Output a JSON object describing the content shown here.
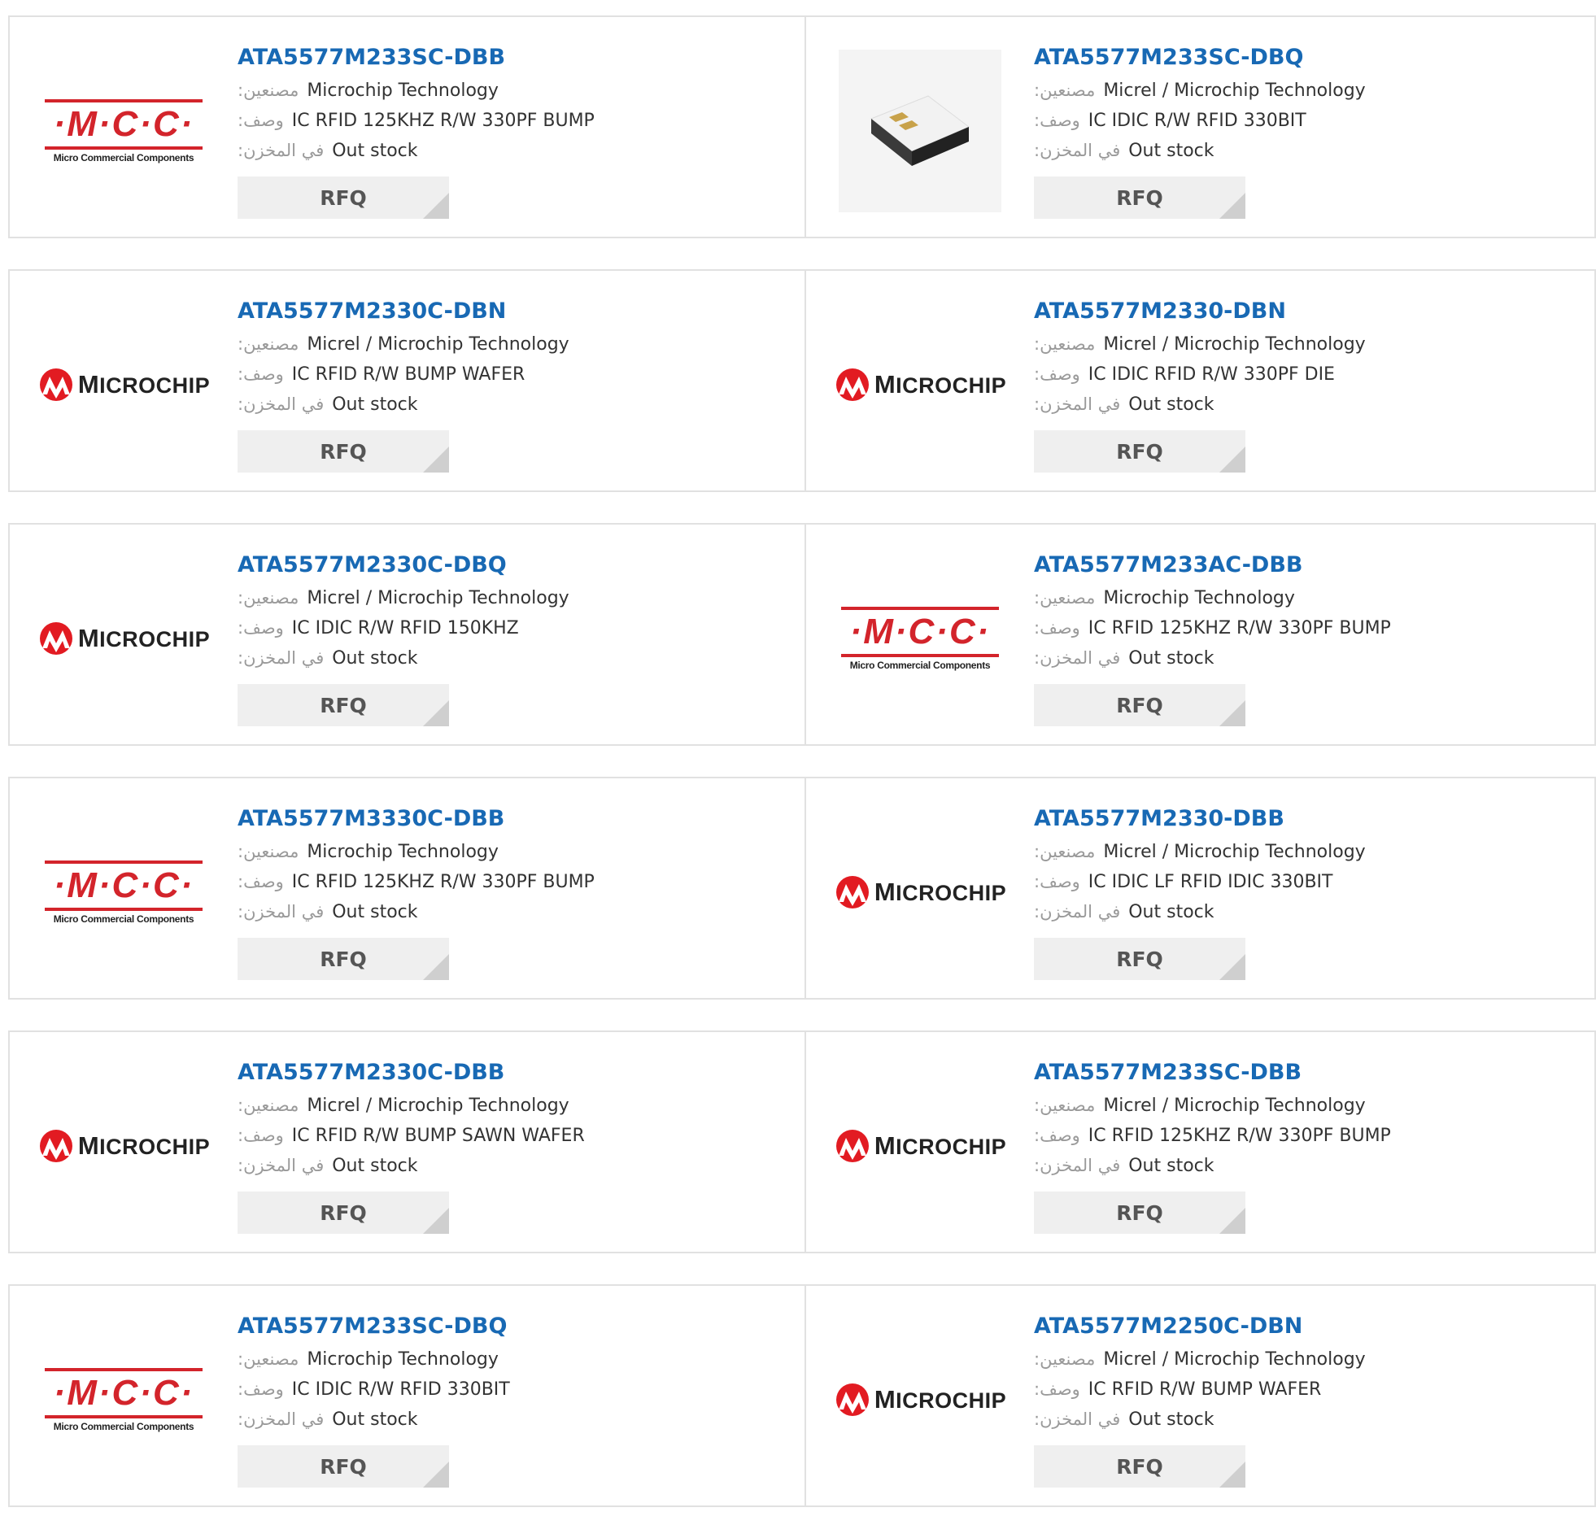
{
  "labels": {
    "manufacturer": ":مصنعين",
    "description": ":وصف",
    "stock": ":في المخزن",
    "rfq": "RFQ"
  },
  "logos": {
    "mcc": {
      "mark": "·M·C·C·",
      "sub": "Micro Commercial Components"
    },
    "microchip": {
      "first": "M",
      "rest": "ICROCHIP"
    }
  },
  "colors": {
    "accent": "#1869b4",
    "mcc_red": "#d3242b",
    "microchip_red": "#e21b22"
  },
  "products": [
    {
      "part": "ATA5577M233SC-DBB",
      "logo": "mcc",
      "manufacturer": "Microchip Technology",
      "description": "IC RFID 125KHZ R/W 330PF BUMP",
      "stock": "Out stock"
    },
    {
      "part": "ATA5577M233SC-DBQ",
      "logo": "chip-photo",
      "manufacturer": "Micrel / Microchip Technology",
      "description": "IC IDIC R/W RFID 330BIT",
      "stock": "Out stock"
    },
    {
      "part": "ATA5577M2330C-DBN",
      "logo": "microchip",
      "manufacturer": "Micrel / Microchip Technology",
      "description": "IC RFID R/W BUMP WAFER",
      "stock": "Out stock"
    },
    {
      "part": "ATA5577M2330-DBN",
      "logo": "microchip",
      "manufacturer": "Micrel / Microchip Technology",
      "description": "IC IDIC RFID R/W 330PF DIE",
      "stock": "Out stock"
    },
    {
      "part": "ATA5577M2330C-DBQ",
      "logo": "microchip",
      "manufacturer": "Micrel / Microchip Technology",
      "description": "IC IDIC R/W RFID 150KHZ",
      "stock": "Out stock"
    },
    {
      "part": "ATA5577M233AC-DBB",
      "logo": "mcc",
      "manufacturer": "Microchip Technology",
      "description": "IC RFID 125KHZ R/W 330PF BUMP",
      "stock": "Out stock"
    },
    {
      "part": "ATA5577M3330C-DBB",
      "logo": "mcc",
      "manufacturer": "Microchip Technology",
      "description": "IC RFID 125KHZ R/W 330PF BUMP",
      "stock": "Out stock"
    },
    {
      "part": "ATA5577M2330-DBB",
      "logo": "microchip",
      "manufacturer": "Micrel / Microchip Technology",
      "description": "IC IDIC LF RFID IDIC 330BIT",
      "stock": "Out stock"
    },
    {
      "part": "ATA5577M2330C-DBB",
      "logo": "microchip",
      "manufacturer": "Micrel / Microchip Technology",
      "description": "IC RFID R/W BUMP SAWN WAFER",
      "stock": "Out stock"
    },
    {
      "part": "ATA5577M233SC-DBB",
      "logo": "microchip",
      "manufacturer": "Micrel / Microchip Technology",
      "description": "IC RFID 125KHZ R/W 330PF BUMP",
      "stock": "Out stock"
    },
    {
      "part": "ATA5577M233SC-DBQ",
      "logo": "mcc",
      "manufacturer": "Microchip Technology",
      "description": "IC IDIC R/W RFID 330BIT",
      "stock": "Out stock"
    },
    {
      "part": "ATA5577M2250C-DBN",
      "logo": "microchip",
      "manufacturer": "Micrel / Microchip Technology",
      "description": "IC RFID R/W BUMP WAFER",
      "stock": "Out stock"
    }
  ]
}
